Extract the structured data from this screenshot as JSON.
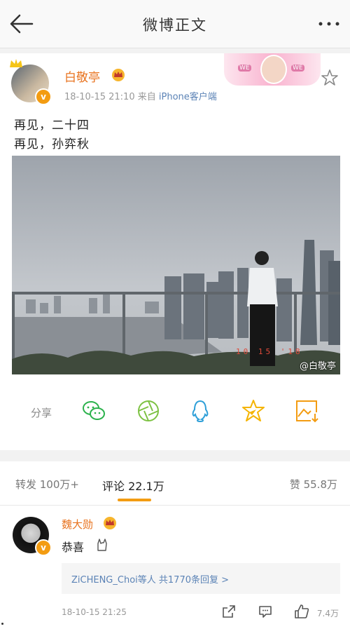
{
  "nav": {
    "title": "微博正文"
  },
  "post": {
    "author": "白敬亭",
    "time": "18-10-15 21:10",
    "source_prefix": "来自",
    "source": "iPhone客户端",
    "text": "再见，二十四\n再见，孙弈秋",
    "watermark": "@白敬亭",
    "photo_stamp": "10 15 '18"
  },
  "share": {
    "label": "分享",
    "icons": [
      "wechat-icon",
      "moments-icon",
      "qq-icon",
      "qzone-icon",
      "save-image-icon"
    ]
  },
  "tabs": {
    "repost": "转发 100万+",
    "comment": "评论 22.1万",
    "like": "赞 55.8万"
  },
  "comment": {
    "author": "魏大勋",
    "text": "恭喜",
    "replies": "ZiCHENG_Choi等人  共1770条回复 >",
    "time": "18-10-15 21:25",
    "likes": "7.4万"
  },
  "colors": {
    "accent": "#f39c12",
    "name": "#e8731f",
    "link": "#5b83b6"
  }
}
